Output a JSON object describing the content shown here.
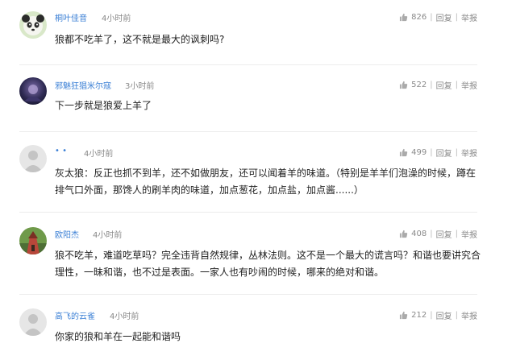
{
  "comments": [
    {
      "username": "桐叶佳音",
      "time": "4小时前",
      "likes": "826",
      "reply": "回复",
      "report": "举报",
      "text": "狼都不吃羊了，这不就是最大的讽刺吗?"
    },
    {
      "username": "邪魅狂猖米尔寇",
      "time": "3小时前",
      "likes": "522",
      "reply": "回复",
      "report": "举报",
      "text": "下一步就是狼爱上羊了"
    },
    {
      "username": "• •",
      "time": "4小时前",
      "likes": "499",
      "reply": "回复",
      "report": "举报",
      "text_line1": "灰太狼：反正也抓不到羊，还不如做朋友，还可以闻着羊的味道。（特别是羊羊们泡澡的时候，蹲在",
      "text_line2": "排气口外面，那馋人的刷羊肉的味道，加点葱花，加点盐，加点酱......）"
    },
    {
      "username": "欧阳杰",
      "time": "4小时前",
      "likes": "408",
      "reply": "回复",
      "report": "举报",
      "text_line1": "狼不吃羊，难道吃草吗？完全违背自然规律，丛林法则。这不是一个最大的谎言吗？和谐也要讲究合",
      "text_line2": "理性，一昧和谐，也不过是表面。一家人也有吵闹的时候，哪来的绝对和谐。"
    },
    {
      "username": "高飞的云雀",
      "time": "4小时前",
      "likes": "212",
      "reply": "回复",
      "report": "举报",
      "text": "你家的狼和羊在一起能和谐吗"
    }
  ],
  "colors": {
    "username": "#3a7fd5",
    "meta": "#888888",
    "text": "#222222",
    "divider": "#ececec"
  },
  "icons": {
    "like": "thumbs-up-icon"
  }
}
